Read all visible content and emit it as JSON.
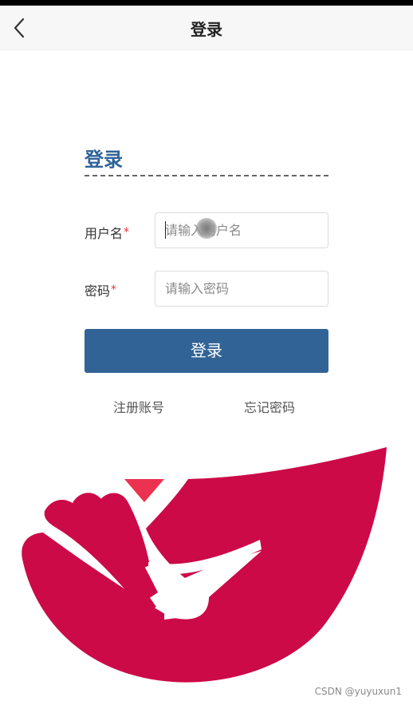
{
  "navbar": {
    "title": "登录",
    "back_icon": "chevron-left-icon"
  },
  "form": {
    "heading": "登录",
    "username": {
      "label": "用户名",
      "required_mark": "*",
      "placeholder": "请输入用户名",
      "value": ""
    },
    "password": {
      "label": "密码",
      "required_mark": "*",
      "placeholder": "请输入密码",
      "value": ""
    },
    "submit_label": "登录",
    "register_link": "注册账号",
    "forgot_link": "忘记密码"
  },
  "logo": {
    "icon": "hand-heart-logo",
    "primary_color": "#cc0a48",
    "accent_color": "#ec3251"
  },
  "watermark": "CSDN @yuyuxun1",
  "colors": {
    "brand": "#326396",
    "heading": "#2f6398",
    "required": "#d9363e"
  }
}
